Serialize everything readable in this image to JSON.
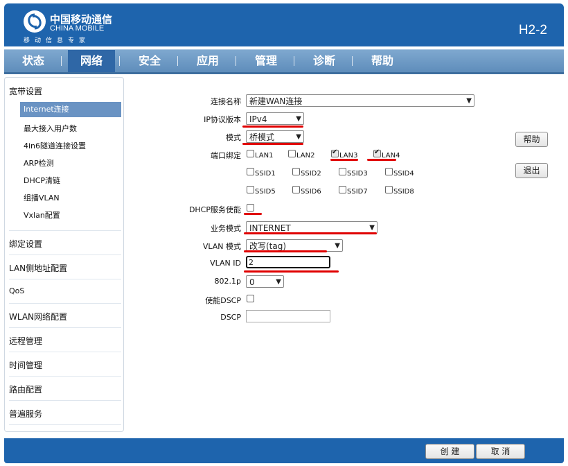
{
  "header": {
    "logo_cn": "中国移动通信",
    "logo_en": "CHINA MOBILE",
    "logo_sub": "移动信息专家",
    "model": "H2-2"
  },
  "nav": {
    "tabs": [
      {
        "label": "状态"
      },
      {
        "label": "网络"
      },
      {
        "label": "安全"
      },
      {
        "label": "应用"
      },
      {
        "label": "管理"
      },
      {
        "label": "诊断"
      },
      {
        "label": "帮助"
      }
    ],
    "active": "网络"
  },
  "sidebar": {
    "broadband": "宽带设置",
    "sub_items": [
      "Internet连接",
      "最大接入用户数",
      "4in6隧道连接设置",
      "ARP检测",
      "DHCP清链",
      "组播VLAN",
      "Vxlan配置"
    ],
    "items": [
      "绑定设置",
      "LAN侧地址配置",
      "QoS",
      "WLAN网络配置",
      "远程管理",
      "时间管理",
      "路由配置",
      "普遍服务"
    ]
  },
  "form": {
    "connection_name_label": "连接名称",
    "connection_name_value": "新建WAN连接",
    "ip_version_label": "IP协议版本",
    "ip_version_value": "IPv4",
    "mode_label": "模式",
    "mode_value": "桥模式",
    "port_binding_label": "端口绑定",
    "ports": [
      {
        "label": "LAN1",
        "checked": false
      },
      {
        "label": "LAN2",
        "checked": false
      },
      {
        "label": "LAN3",
        "checked": true
      },
      {
        "label": "LAN4",
        "checked": true
      },
      {
        "label": "SSID1",
        "checked": false
      },
      {
        "label": "SSID2",
        "checked": false
      },
      {
        "label": "SSID3",
        "checked": false
      },
      {
        "label": "SSID4",
        "checked": false
      },
      {
        "label": "SSID5",
        "checked": false
      },
      {
        "label": "SSID6",
        "checked": false
      },
      {
        "label": "SSID7",
        "checked": false
      },
      {
        "label": "SSID8",
        "checked": false
      }
    ],
    "dhcp_label": "DHCP服务使能",
    "dhcp_enabled": false,
    "service_mode_label": "业务模式",
    "service_mode_value": "INTERNET",
    "vlan_mode_label": "VLAN 模式",
    "vlan_mode_value": "改写(tag)",
    "vlan_id_label": "VLAN ID",
    "vlan_id_value": "2",
    "dot1p_label": "802.1p",
    "dot1p_value": "0",
    "dscp_enable_label": "使能DSCP",
    "dscp_enabled": false,
    "dscp_label": "DSCP",
    "dscp_value": ""
  },
  "buttons": {
    "help": "帮助",
    "exit": "退出",
    "create": "创 建",
    "cancel": "取 消"
  },
  "colors": {
    "header_blue": "#1e64ad",
    "nav_blue": "#6a93c3",
    "annotation_red": "#e00000"
  }
}
